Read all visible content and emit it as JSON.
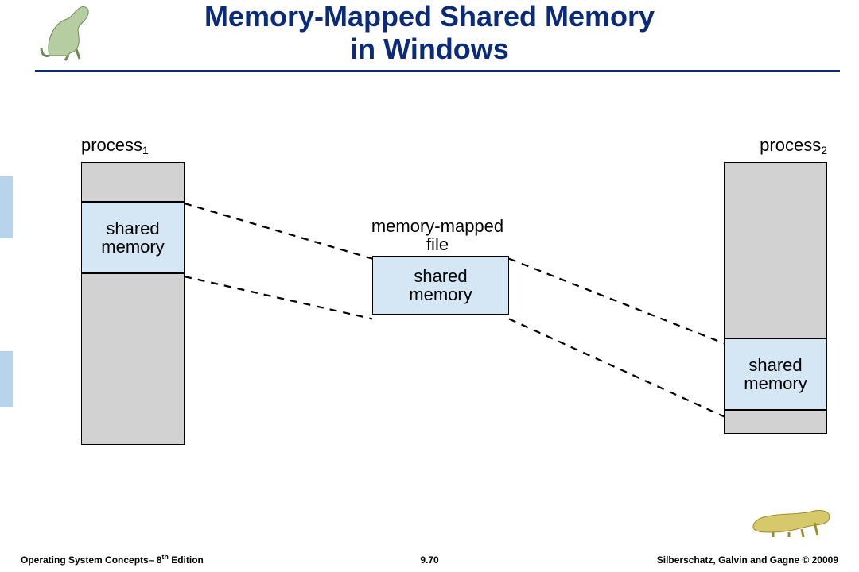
{
  "title": {
    "line1": "Memory-Mapped Shared Memory",
    "line2": "in Windows"
  },
  "labels": {
    "process1": "process",
    "process1_sub": "1",
    "process2": "process",
    "process2_sub": "2",
    "mmfile": "memory-mapped\nfile",
    "shared1": "shared\nmemory",
    "sharedC": "shared\nmemory",
    "shared2": "shared\nmemory"
  },
  "footer": {
    "left_pre": "Operating System Concepts– 8",
    "left_sup": "th",
    "left_post": " Edition",
    "center": "9.70",
    "right": "Silberschatz, Galvin and Gagne © 20009"
  },
  "icons": {
    "dino_tl": "dinosaur-icon",
    "dino_br": "dinosaur-icon"
  },
  "colors": {
    "accent": "#0a2a7a",
    "shared_fill": "#d5e6f5",
    "block_fill": "#d2d2d2",
    "sidebar": "#b7d4ec"
  }
}
